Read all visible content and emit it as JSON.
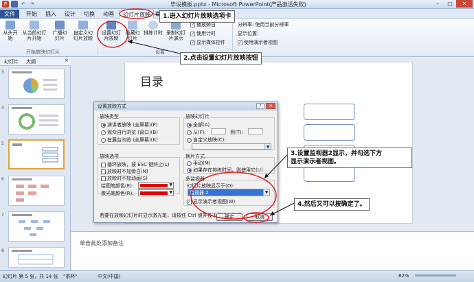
{
  "titlebar": {
    "title": "毕设模板.pptx - Microsoft PowerPoint(产品激活失败)",
    "qa_icons": [
      "powerpoint-logo-icon",
      "save-icon",
      "undo-icon",
      "redo-icon"
    ],
    "buttons": {
      "minimize": "–",
      "restore": "□",
      "close": "✕"
    }
  },
  "tabs": {
    "file": "文件",
    "items": [
      "开始",
      "插入",
      "设计",
      "切换",
      "动画",
      "幻灯片放映",
      "审阅",
      "视图"
    ]
  },
  "ribbon": {
    "start_group": {
      "label": "开始放映幻灯片",
      "buttons": [
        "从头开始",
        "从当前幻灯片开始",
        "广播幻灯片",
        "自定义幻灯片放映"
      ]
    },
    "setup_group": {
      "label": "设置",
      "buttons": [
        "设置幻灯片放映",
        "隐藏幻灯片",
        "排练计时",
        "录制幻灯片演示"
      ],
      "checkboxes": [
        "播放旁白",
        "使用计时",
        "显示媒体控件"
      ]
    },
    "monitor_group": {
      "resolution_label": "分辨率:",
      "resolution_value": "使用当前分辨率",
      "show_on_label": "显示位置:",
      "presenter_view": "使用演示者视图"
    }
  },
  "leftpanel": {
    "tabs": [
      "幻灯片",
      "大纲"
    ],
    "thumb_numbers": [
      "3",
      "4",
      "5",
      "6",
      "7",
      "8"
    ],
    "selected_index": 2
  },
  "slide": {
    "title": "目录"
  },
  "notes": {
    "placeholder": "单击此处添加备注"
  },
  "statusbar": {
    "slide_info": "幻灯片 第 5 张，共 14 张",
    "theme": "\"茶杯\"",
    "language": "中文(中国)",
    "zoom": "82%"
  },
  "dialog": {
    "title": "设置放映方式",
    "help": "?",
    "close": "✕",
    "show_type": {
      "legend": "放映类型",
      "options": [
        "演讲者放映 (全屏幕)(P)",
        "观众自行浏览 (窗口)(B)",
        "在展台浏览 (全屏幕)(K)"
      ]
    },
    "show_options": {
      "legend": "放映选项",
      "options": [
        "循环放映，按 ESC 键终止(L)",
        "放映时不加旁白(N)",
        "放映时不加动画(S)"
      ],
      "pen_color_label": "绘图笔颜色(E):",
      "laser_color_label": "激光笔颜色(R):"
    },
    "slides": {
      "legend": "放映幻灯片",
      "all": "全部(A)",
      "from": "从(F):",
      "to": "到(T):",
      "custom": "自定义放映(C):"
    },
    "advance": {
      "legend": "换片方式",
      "manual": "手动(M)",
      "timings": "如果存在排练时间，则使用它(U)"
    },
    "monitors": {
      "legend": "多监视器",
      "show_on_label": "幻灯片放映显示于(O):",
      "show_on_value": "监视器 2",
      "presenter_view": "显示演示者视图(W)"
    },
    "note": "若要在放映幻灯片时显示激光笔，请按住 Ctrl 键并按下鼠标左按钮。",
    "ok": "确定",
    "cancel": "取消",
    "pen_color": "#e00000",
    "laser_color": "#e00000"
  },
  "annotations": {
    "step1": "1.进入幻灯片放映选项卡",
    "step2": "2.点击设置幻灯片放映按钮",
    "step3_line1": "3.设置监视器2显示，并勾选下方",
    "step3_line2": "显示演示者视图。",
    "step4": "4.然后又可以按确定了。"
  },
  "colors": {
    "accent": "#2b5797",
    "annotation_red": "#e02020",
    "selection_orange": "#e0a43b"
  }
}
